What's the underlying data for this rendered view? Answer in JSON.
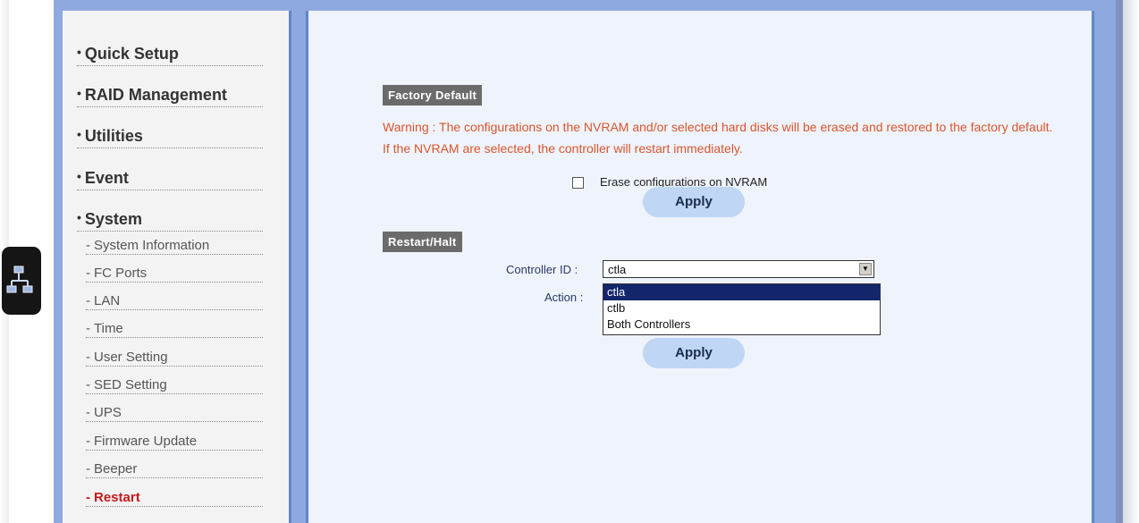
{
  "sidebar": {
    "items": [
      {
        "label": "Quick Setup"
      },
      {
        "label": "RAID Management"
      },
      {
        "label": "Utilities"
      },
      {
        "label": "Event"
      },
      {
        "label": "System"
      }
    ],
    "system_subitems": [
      {
        "label": "System Information"
      },
      {
        "label": "FC Ports"
      },
      {
        "label": "LAN"
      },
      {
        "label": "Time"
      },
      {
        "label": "User Setting"
      },
      {
        "label": "SED Setting"
      },
      {
        "label": "UPS"
      },
      {
        "label": "Firmware Update"
      },
      {
        "label": "Beeper"
      },
      {
        "label": "Restart"
      }
    ],
    "active_item": "Restart",
    "bullet": "•",
    "dash": "-"
  },
  "factory_default": {
    "title": "Factory Default",
    "warning": "Warning : The configurations on the NVRAM and/or selected hard disks will be erased and restored to the factory default. If the NVRAM are selected, the controller will restart immediately.",
    "checkbox_label": "Erase configurations on NVRAM",
    "checkbox_checked": false,
    "apply_label": "Apply"
  },
  "restart_halt": {
    "title": "Restart/Halt",
    "controller_label": "Controller ID :",
    "controller_value": "ctla",
    "action_label": "Action :",
    "options": [
      "ctla",
      "ctlb",
      "Both Controllers"
    ],
    "selected_option": "ctla",
    "apply_label": "Apply"
  },
  "icons": {
    "side_tab": "network-icon",
    "dropdown_arrow": "chevron-down-icon"
  },
  "colors": {
    "frame": "#8ea9e0",
    "border": "#5f86cf",
    "warning_text": "#d9562c",
    "active_nav": "#c41a1a",
    "button_bg": "#bfd6f5",
    "header_bg": "#6b6b6b",
    "selected_option_bg": "#13256b"
  }
}
